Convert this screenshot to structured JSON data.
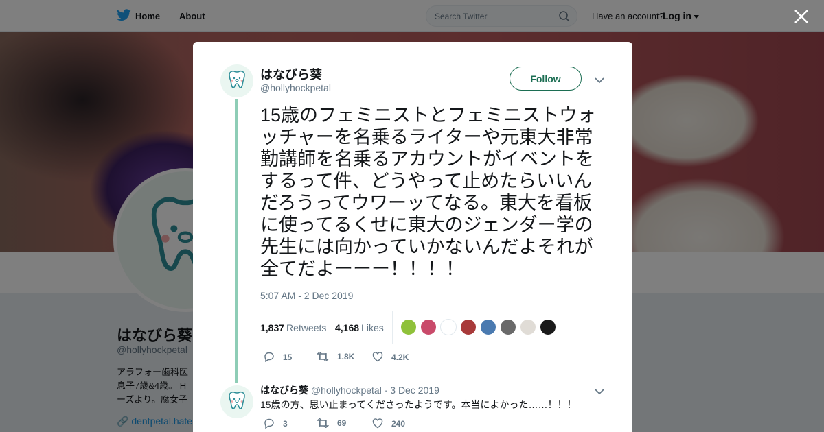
{
  "nav": {
    "home_label": "Home",
    "about_label": "About",
    "search_placeholder": "Search Twitter",
    "have_account": "Have an account?",
    "login_label": "Log in"
  },
  "profile": {
    "name": "はなびら葵",
    "handle": "@hollyhockpetal",
    "bio": "アラフォー歯科医\n息子7歳&4歳。 H\nーズより。腐女子",
    "link": "dentpetal.hate"
  },
  "tweet": {
    "name": "はなびら葵",
    "handle": "@hollyhockpetal",
    "follow_label": "Follow",
    "text": "15歳のフェミニストとフェミニストウォッチャーを名乗るライターや元東大非常勤講師を名乗るアカウントがイベントをするって件、どうやって止めたらいいんだろうってウワーッてなる。東大を看板に使ってるくせに東大のジェンダー学の先生には向かっていかないんだよそれが全てだよーーー！！！！",
    "timestamp": "5:07 AM - 2 Dec 2019",
    "retweets_count": "1,837",
    "retweets_label": "Retweets",
    "likes_count": "4,168",
    "likes_label": "Likes",
    "actions": {
      "replies": "15",
      "retweets": "1.8K",
      "likes": "4.2K"
    },
    "likers": [
      "#8fc13a",
      "#c94a6a",
      "#ffffff",
      "#a83a3a",
      "#4a7ab0",
      "#6a6a6a",
      "#e0dcd6",
      "#1a1a1a"
    ]
  },
  "reply": {
    "name": "はなびら葵",
    "handle": "@hollyhockpetal",
    "date": "· 3 Dec 2019",
    "text": "15歳の方、思い止まってくださったようです。本当によかった……！！！",
    "actions": {
      "replies": "3",
      "retweets": "69",
      "likes": "240"
    }
  },
  "colors": {
    "accent": "#1c6e53",
    "thread": "#8ecdb6",
    "twitter_blue": "#1da1f2"
  }
}
